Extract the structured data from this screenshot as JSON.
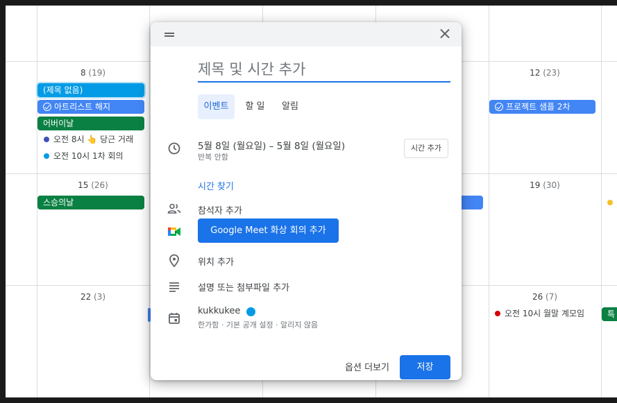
{
  "calendar": {
    "days": [
      {
        "num": "8",
        "count": "(19)"
      },
      {
        "num": "12",
        "count": "(23)"
      },
      {
        "num": "15",
        "count": "(26)"
      },
      {
        "num": "19",
        "count": "(30)"
      },
      {
        "num": "22",
        "count": "(3)"
      },
      {
        "num": "26",
        "count": "(7)"
      }
    ],
    "events": {
      "no_title": "(제목 없음)",
      "artist_cancel": "아트리스트 해지",
      "childrens_day": "어버이날",
      "carrot_trade": "오전 8시 👆 당근 거래",
      "first_meeting": "오전 10시 1차 회의",
      "teachers_day": "스승의날",
      "project_sample": "프로젝트 샘플 2차",
      "monthly_meeting": "오전 10시 월말 계모임",
      "partial_right": "특"
    },
    "colors": {
      "light_blue": "#039be5",
      "blue": "#4285f4",
      "green": "#0b8043",
      "indigo": "#3f51b5",
      "red": "#d50000",
      "yellow": "#f6bf26"
    }
  },
  "dialog": {
    "title_placeholder": "제목 및 시간 추가",
    "tabs": [
      {
        "label": "이벤트"
      },
      {
        "label": "할 일"
      },
      {
        "label": "알림"
      }
    ],
    "date_range": "5월 8일 (월요일)   –   5월 8일 (월요일)",
    "repeat": "반복 안함",
    "add_time": "시간 추가",
    "find_time": "시간 찾기",
    "add_guests": "참석자 추가",
    "meet_button": "Google Meet 화상 회의 추가",
    "add_location": "위치 추가",
    "add_description": "설명 또는 첨부파일 추가",
    "calendar_name": "kukkukee",
    "calendar_details": "한가함 · 기본 공개 설정 · 알리지 않음",
    "more_options": "옵션 더보기",
    "save": "저장"
  }
}
